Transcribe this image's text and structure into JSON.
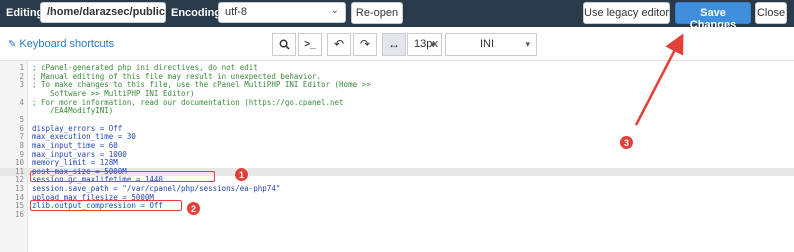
{
  "topbar": {
    "editing_label": "Editing:",
    "file_path": "/home/darazsec/public_ht",
    "encoding_label": "Encoding:",
    "encoding_value": "utf-8",
    "reopen_label": "Re-open",
    "legacy_label": "Use legacy editor",
    "save_label": "Save Changes",
    "close_label": "Close"
  },
  "toolbar": {
    "keyboard_shortcuts": "Keyboard shortcuts",
    "search_icon": "search-icon",
    "terminal_icon": "terminal-icon",
    "undo_icon": "undo-icon",
    "redo_icon": "redo-icon",
    "wrap_icon": "wrap-icon",
    "font_size": "13px",
    "mode": "INI"
  },
  "editor": {
    "lines": [
      {
        "n": "1",
        "text": "; cPanel-generated php ini directives, do not edit",
        "type": "comment"
      },
      {
        "n": "2",
        "text": "; Manual editing of this file may result in unexpected behavior.",
        "type": "comment"
      },
      {
        "n": "3",
        "text": "; To make changes to this file, use the cPanel MultiPHP INI Editor (Home >>",
        "type": "comment"
      },
      {
        "n": "",
        "text": "    Software >> MultiPHP INI Editor)",
        "type": "comment"
      },
      {
        "n": "4",
        "text": "; For more information, read our documentation (https://go.cpanel.net",
        "type": "comment"
      },
      {
        "n": "",
        "text": "    /EA4ModifyINI)",
        "type": "comment"
      },
      {
        "n": "5",
        "text": "",
        "type": "plain"
      },
      {
        "n": "6",
        "text": "display_errors = Off",
        "type": "setting"
      },
      {
        "n": "7",
        "text": "max_execution_time = 30",
        "type": "setting"
      },
      {
        "n": "8",
        "text": "max_input_time = 60",
        "type": "setting"
      },
      {
        "n": "9",
        "text": "max_input_vars = 1000",
        "type": "setting"
      },
      {
        "n": "10",
        "text": "memory_limit = 128M",
        "type": "setting"
      },
      {
        "n": "11",
        "text": "post_max_size = 5000M",
        "type": "setting"
      },
      {
        "n": "12",
        "text": "session.gc_maxlifetime = 1440",
        "type": "setting"
      },
      {
        "n": "13",
        "text": "session.save_path = \"/var/cpanel/php/sessions/ea-php74\"",
        "type": "setting"
      },
      {
        "n": "14",
        "text": "upload_max_filesize = 5000M",
        "type": "setting"
      },
      {
        "n": "15",
        "text": "zlib.output_compression = Off",
        "type": "setting"
      },
      {
        "n": "16",
        "text": "",
        "type": "plain"
      }
    ]
  },
  "annotations": {
    "badge1": "1",
    "badge2": "2",
    "badge3": "3",
    "color": "#e3403a"
  }
}
